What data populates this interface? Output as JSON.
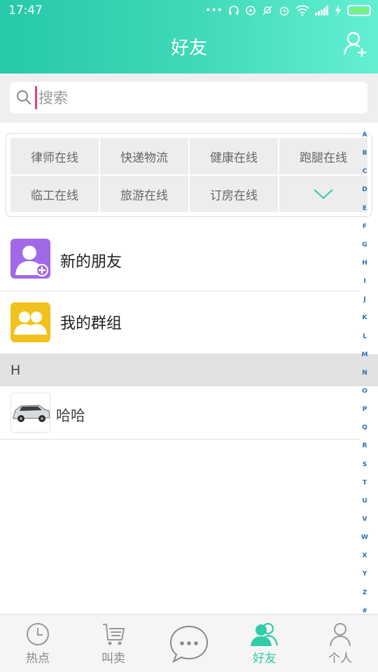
{
  "status_bar": {
    "time": "17:47"
  },
  "header": {
    "title": "好友"
  },
  "search": {
    "placeholder": "搜索"
  },
  "categories": [
    "律师在线",
    "快递物流",
    "健康在线",
    "跑腿在线",
    "临工在线",
    "旅游在线",
    "订房在线"
  ],
  "list": {
    "new_friends": "新的朋友",
    "my_groups": "我的群组",
    "section_letter": "H",
    "contacts": [
      {
        "name": "哈哈"
      }
    ]
  },
  "alphabet": [
    "A",
    "B",
    "C",
    "D",
    "E",
    "F",
    "G",
    "H",
    "I",
    "J",
    "K",
    "L",
    "M",
    "N",
    "O",
    "P",
    "Q",
    "R",
    "S",
    "T",
    "U",
    "V",
    "W",
    "X",
    "Y",
    "Z",
    "#"
  ],
  "bottom_nav": {
    "tabs": [
      {
        "label": "热点",
        "icon": "clock-icon"
      },
      {
        "label": "叫卖",
        "icon": "cart-icon"
      },
      {
        "label": "",
        "icon": "chat-bubble-icon"
      },
      {
        "label": "好友",
        "icon": "friends-icon"
      },
      {
        "label": "个人",
        "icon": "person-icon"
      }
    ]
  },
  "colors": {
    "accent": "#2fcca9",
    "header_start": "#26c9a9",
    "header_end": "#63f0d2",
    "new_friend_avatar": "#a169e8",
    "group_avatar": "#f2c21c"
  }
}
